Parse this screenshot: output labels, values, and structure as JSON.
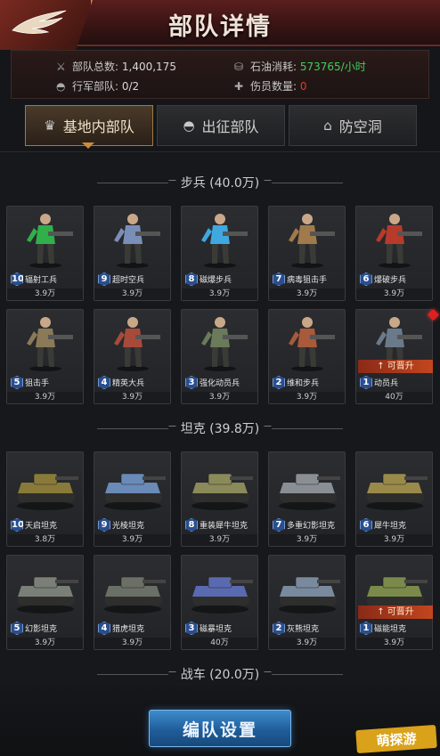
{
  "header": {
    "title": "部队详情"
  },
  "stats": {
    "total_label": "部队总数:",
    "total_value": "1,400,175",
    "march_label": "行军部队:",
    "march_value": "0/2",
    "oil_label": "石油消耗:",
    "oil_value": "573765/小时",
    "wounded_label": "伤员数量:",
    "wounded_value": "0"
  },
  "tabs": [
    {
      "label": "基地内部队",
      "icon": "base-icon",
      "active": true
    },
    {
      "label": "出征部队",
      "icon": "helmet-icon",
      "active": false
    },
    {
      "label": "防空洞",
      "icon": "bunker-icon",
      "active": false
    }
  ],
  "sections": {
    "infantry": "步兵 (40.0万)",
    "tank": "坦克 (39.8万)",
    "vehicle": "战车 (20.0万)"
  },
  "infantry": [
    {
      "level": "10",
      "name": "辐射工兵",
      "cost": "3.9万",
      "color": "#2fb04a"
    },
    {
      "level": "9",
      "name": "超时空兵",
      "cost": "3.9万",
      "color": "#7a8fb8"
    },
    {
      "level": "8",
      "name": "磁爆步兵",
      "cost": "3.9万",
      "color": "#3fa8e0"
    },
    {
      "level": "7",
      "name": "病毒狙击手",
      "cost": "3.9万",
      "color": "#a07a4a"
    },
    {
      "level": "6",
      "name": "爆破步兵",
      "cost": "3.9万",
      "color": "#b83a2a"
    },
    {
      "level": "5",
      "name": "狙击手",
      "cost": "3.9万",
      "color": "#8a7a58"
    },
    {
      "level": "4",
      "name": "精英大兵",
      "cost": "3.9万",
      "color": "#a84a3a"
    },
    {
      "level": "3",
      "name": "强化动员兵",
      "cost": "3.9万",
      "color": "#6a7a5a"
    },
    {
      "level": "2",
      "name": "维和步兵",
      "cost": "3.9万",
      "color": "#a85a3a"
    },
    {
      "level": "1",
      "name": "动员兵",
      "cost": "40万",
      "color": "#6a7a8a",
      "upgrade": "↑ 可晋升"
    }
  ],
  "tanks": [
    {
      "level": "10",
      "name": "天启坦克",
      "cost": "3.8万",
      "color": "#8a7a3a"
    },
    {
      "level": "9",
      "name": "光棱坦克",
      "cost": "3.9万",
      "color": "#6a8ab8"
    },
    {
      "level": "8",
      "name": "重装犀牛坦克",
      "cost": "3.9万",
      "color": "#8a8a5a"
    },
    {
      "level": "7",
      "name": "多重幻影坦克",
      "cost": "3.9万",
      "color": "#8a8f96"
    },
    {
      "level": "6",
      "name": "犀牛坦克",
      "cost": "3.9万",
      "color": "#9a8a4a"
    },
    {
      "level": "5",
      "name": "幻影坦克",
      "cost": "3.9万",
      "color": "#7a7f78"
    },
    {
      "level": "4",
      "name": "猎虎坦克",
      "cost": "3.9万",
      "color": "#6a7066"
    },
    {
      "level": "3",
      "name": "磁暴坦克",
      "cost": "40万",
      "color": "#5a6ab0"
    },
    {
      "level": "2",
      "name": "灰熊坦克",
      "cost": "3.9万",
      "color": "#7a8a9e"
    },
    {
      "level": "1",
      "name": "磁能坦克",
      "cost": "3.9万",
      "color": "#7a8a4a",
      "upgrade": "↑ 可晋升"
    }
  ],
  "buttons": {
    "formation": "编队设置"
  },
  "watermark": "萌探游"
}
